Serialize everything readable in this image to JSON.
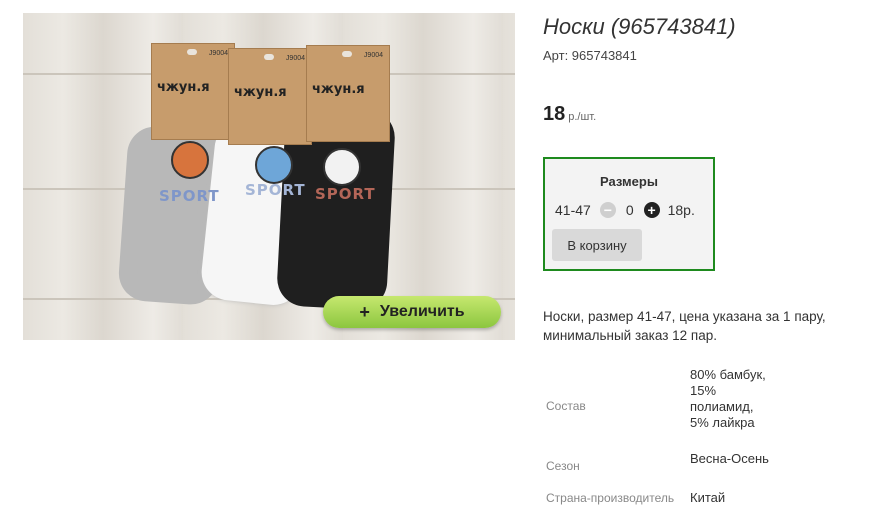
{
  "gallery": {
    "zoom_label": "Увеличить",
    "zoom_icon": "plus-icon",
    "photo_text": {
      "tag_brand": "чжун.я",
      "tag_codes": [
        "J9004",
        "J9004",
        "J9004"
      ],
      "sock_print": "SPORT"
    }
  },
  "product": {
    "title": "Носки (965743841)",
    "article": "Арт: 965743841",
    "price_value": "18",
    "price_unit": "р./шт."
  },
  "sizes": {
    "header": "Размеры",
    "size": "41-47",
    "quantity": "0",
    "sum": "18р.",
    "cart_label": "В корзину",
    "accent_color": "#1e8a1e"
  },
  "description": "Носки, размер 41-47, цена указана за 1 пару, минимальный заказ 12 пар.",
  "properties": [
    {
      "label": "Состав",
      "value": "80% бамбук, 15% полиамид, 5% лайкра"
    },
    {
      "label": "Сезон",
      "value": "Весна-Осень"
    },
    {
      "label": "Страна-производитель",
      "value": "Китай"
    }
  ]
}
